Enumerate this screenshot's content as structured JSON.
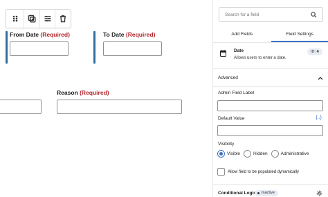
{
  "canvas": {
    "toolbar": {
      "icons": [
        "drag-handle-icon",
        "duplicate-icon",
        "settings-sliders-icon",
        "trash-icon"
      ]
    },
    "fields": {
      "from_date": {
        "label": "From Date",
        "required": "(Required)"
      },
      "to_date": {
        "label": "To Date",
        "required": "(Required)"
      },
      "reason": {
        "label": "Reason",
        "required": "(Required)"
      }
    },
    "accent_color": "#2e6ea3",
    "required_color": "#b3262c"
  },
  "sidebar": {
    "search": {
      "placeholder": "Search for a field",
      "icon": "search-icon"
    },
    "tabs": [
      {
        "label": "Add Fields",
        "active": false
      },
      {
        "label": "Field Settings",
        "active": true
      }
    ],
    "field": {
      "icon": "calendar-icon",
      "name": "Date",
      "description": "Allows users to enter a date.",
      "id_label": "ID:",
      "id_value": "4"
    },
    "advanced": {
      "title": "Advanced",
      "admin_label": "Admin Field Label",
      "admin_value": "",
      "default_label": "Default Value",
      "default_value": "",
      "merge_tag": "{..}",
      "visibility_label": "Visibility",
      "visibility_options": [
        "Visible",
        "Hidden",
        "Administrative"
      ],
      "visibility_selected": "Visible",
      "dynamic_label": "Allow field to be populated dynamically",
      "dynamic_checked": false
    },
    "conditional_logic": {
      "label": "Conditional Logic",
      "status": "Inactive"
    },
    "tab_accent_color": "#3b6fc7"
  }
}
